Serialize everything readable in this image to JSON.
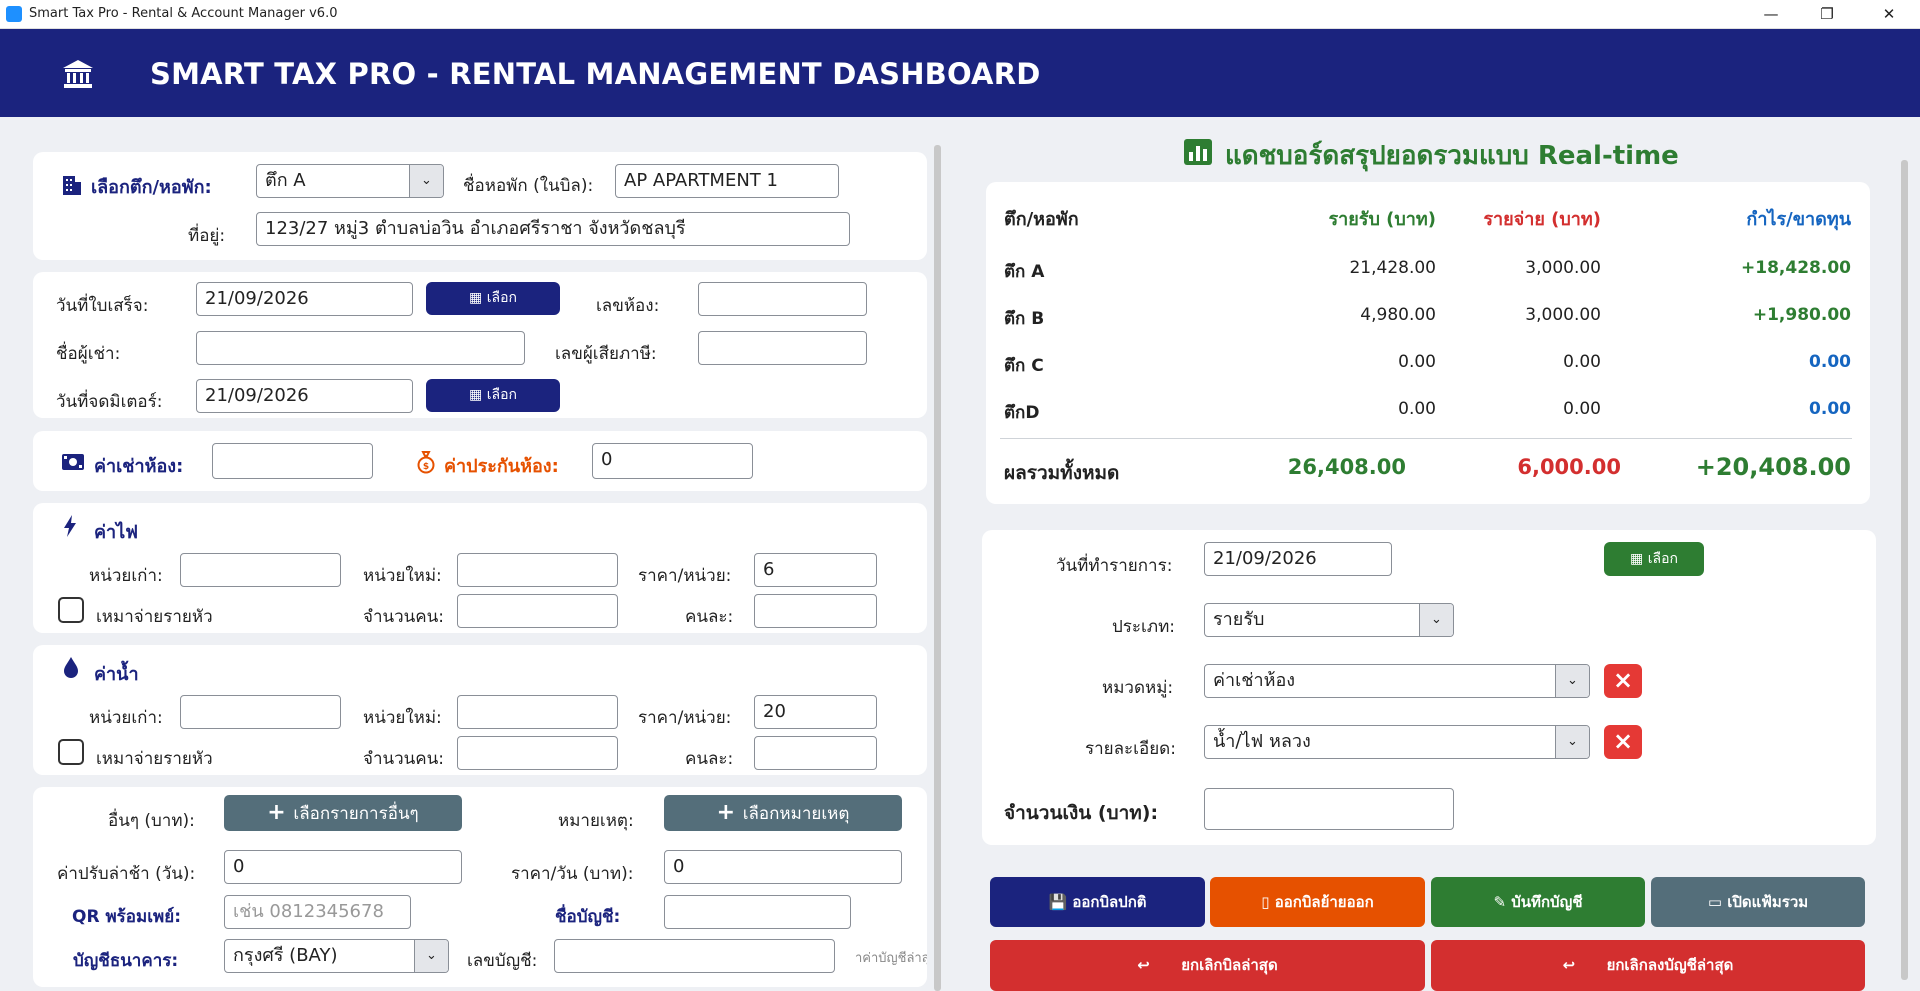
{
  "window": {
    "title": "Smart Tax Pro - Rental & Account Manager v6.0",
    "minimize": "—",
    "maximize": "❐",
    "close": "✕"
  },
  "header": {
    "title": "SMART TAX PRO - RENTAL MANAGEMENT DASHBOARD"
  },
  "property": {
    "building_label": "เลือกตึก/หอพัก:",
    "building_value": "ตึก A",
    "dorm_name_label": "ชื่อหอพัก (ในบิล):",
    "dorm_name_value": "AP APARTMENT 1",
    "address_label": "ที่อยู่:",
    "address_value": "123/27 หมู่3 ตำบลบ่อวิน อำเภอศรีราชา จังหวัดชลบุรี"
  },
  "tenant": {
    "receipt_date_label": "วันที่ใบเสร็จ:",
    "receipt_date_value": "21/09/2026",
    "pick_label": "เลือก",
    "room_no_label": "เลขห้อง:",
    "room_no_value": "",
    "tenant_name_label": "ชื่อผู้เช่า:",
    "tenant_name_value": "",
    "tax_id_label": "เลขผู้เสียภาษี:",
    "tax_id_value": "",
    "meter_date_label": "วันที่จดมิเตอร์:",
    "meter_date_value": "21/09/2026"
  },
  "rent": {
    "rent_label": "ค่าเช่าห้อง:",
    "rent_value": "",
    "deposit_label": "ค่าประกันห้อง:",
    "deposit_value": "0"
  },
  "electric": {
    "title": "ค่าไฟ",
    "old_unit_label": "หน่วยเก่า:",
    "new_unit_label": "หน่วยใหม่:",
    "price_label": "ราคา/หน่วย:",
    "price_value": "6",
    "flat_label": "เหมาจ่ายรายหัว",
    "people_label": "จำนวนคน:",
    "per_person_label": "คนละ:"
  },
  "water": {
    "title": "ค่าน้ำ",
    "old_unit_label": "หน่วยเก่า:",
    "new_unit_label": "หน่วยใหม่:",
    "price_label": "ราคา/หน่วย:",
    "price_value": "20",
    "flat_label": "เหมาจ่ายรายหัว",
    "people_label": "จำนวนคน:",
    "per_person_label": "คนละ:"
  },
  "other": {
    "other_label": "อื่นๆ (บาท):",
    "other_button": "เลือกรายการอื่นๆ",
    "note_label": "หมายเหตุ:",
    "note_button": "เลือกหมายเหตุ",
    "late_fee_label": "ค่าปรับล่าช้า (วัน):",
    "late_fee_value": "0",
    "per_day_label": "ราคา/วัน (บาท):",
    "per_day_value": "0",
    "qr_label": "QR พร้อมเพย์:",
    "qr_placeholder": "เช่น 0812345678",
    "account_name_label": "ชื่อบัญชี:",
    "bank_label": "บัญชีธนาคาร:",
    "bank_value": "กรุงศรี (BAY)",
    "account_no_label": "เลขบัญชี:",
    "hint": "าค่าบัญชีล่าสุดไว้ใ"
  },
  "dashboard": {
    "title": "แดชบอร์ดสรุปยอดรวมแบบ Real-time",
    "headers": {
      "building": "ตึก/หอพัก",
      "income": "รายรับ (บาท)",
      "expense": "รายจ่าย (บาท)",
      "profit": "กำไร/ขาดทุน"
    },
    "rows": [
      {
        "name": "ตึก A",
        "income": "21,428.00",
        "expense": "3,000.00",
        "profit": "+18,428.00"
      },
      {
        "name": "ตึก B",
        "income": "4,980.00",
        "expense": "3,000.00",
        "profit": "+1,980.00"
      },
      {
        "name": "ตึก C",
        "income": "0.00",
        "expense": "0.00",
        "profit": "0.00"
      },
      {
        "name": "ตึกD",
        "income": "0.00",
        "expense": "0.00",
        "profit": "0.00"
      }
    ],
    "total": {
      "label": "ผลรวมทั้งหมด",
      "income": "26,408.00",
      "expense": "6,000.00",
      "profit": "+20,408.00"
    }
  },
  "transaction": {
    "date_label": "วันที่ทำรายการ:",
    "date_value": "21/09/2026",
    "pick_label": "เลือก",
    "type_label": "ประเภท:",
    "type_value": "รายรับ",
    "category_label": "หมวดหมู่:",
    "category_value": "ค่าเช่าห้อง",
    "detail_label": "รายละเอียด:",
    "detail_value": "น้ำ/ไฟ หลวง",
    "amount_label": "จำนวนเงิน (บาท):",
    "amount_value": ""
  },
  "actions": {
    "normal_bill": "ออกบิลปกติ",
    "moveout_bill": "ออกบิลย้ายออก",
    "save_account": "บันทึกบัญชี",
    "open_folder": "เปิดแฟ้มรวม",
    "cancel_last_bill": "ยกเลิกบิลล่าสุด",
    "cancel_last_account": "ยกเลิกลงบัญชีล่าสุด",
    "undo_glyph": "↩"
  },
  "colors": {
    "navy": "#1b237e",
    "income_green": "#2e7d32",
    "expense_red": "#d32f2f",
    "profit_blue": "#1565c0",
    "orange": "#e65100",
    "gray": "#546e7a"
  }
}
